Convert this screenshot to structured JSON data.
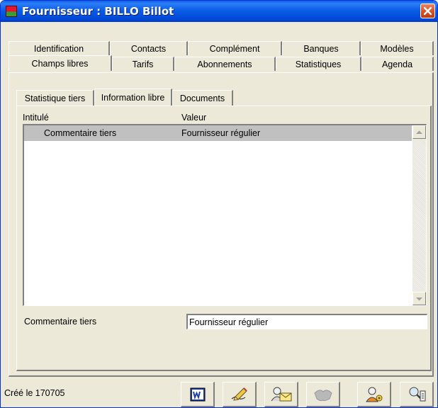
{
  "window": {
    "title": "Fournisseur : BILLO Billot"
  },
  "tabs_top": [
    {
      "label": "Identification"
    },
    {
      "label": "Contacts"
    },
    {
      "label": "Complément"
    },
    {
      "label": "Banques"
    },
    {
      "label": "Modèles"
    }
  ],
  "tabs_bottom": [
    {
      "label": "Champs libres",
      "active": true
    },
    {
      "label": "Tarifs"
    },
    {
      "label": "Abonnements"
    },
    {
      "label": "Statistiques"
    },
    {
      "label": "Agenda"
    }
  ],
  "inner_tabs": [
    {
      "label": "Statistique tiers"
    },
    {
      "label": "Information libre",
      "active": true
    },
    {
      "label": "Documents"
    }
  ],
  "list": {
    "headers": {
      "intitule": "Intitulé",
      "valeur": "Valeur"
    },
    "rows": [
      {
        "intitule": "Commentaire tiers",
        "valeur": "Fournisseur régulier",
        "selected": true
      }
    ]
  },
  "field": {
    "label": "Commentaire tiers",
    "value": "Fournisseur régulier"
  },
  "status": {
    "created": "Créé le 170705"
  },
  "toolbar": {
    "buttons": [
      {
        "icon": "word-icon"
      },
      {
        "icon": "edit-pencil-icon"
      },
      {
        "icon": "email-users-icon"
      },
      {
        "icon": "handshake-icon",
        "disabled": true
      },
      {
        "icon": "user-settings-icon"
      },
      {
        "icon": "user-search-icon"
      }
    ]
  },
  "colors": {
    "titlebar": "#0149d6",
    "face": "#ece9d8",
    "selection": "#c0c0c0",
    "close": "#d84a1f"
  }
}
